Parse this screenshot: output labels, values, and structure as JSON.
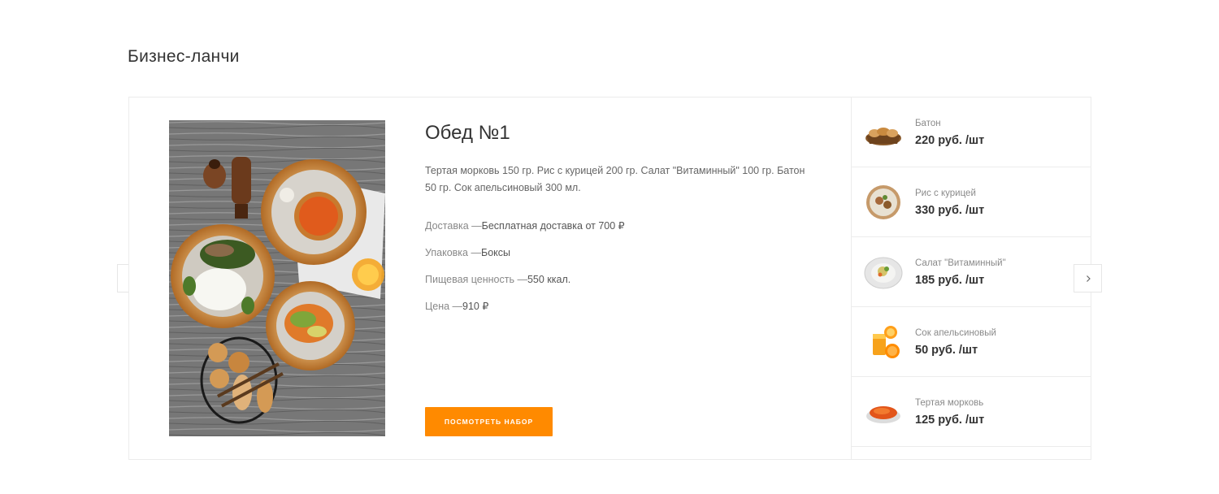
{
  "section": {
    "title": "Бизнес-ланчи"
  },
  "lunch": {
    "title": "Обед №1",
    "description": "Тертая морковь 150 гр.  Рис с курицей 200 гр.  Салат \"Витаминный\" 100 гр.  Батон 50 гр.  Сок апельсиновый 300 мл.",
    "properties": [
      {
        "label": "Доставка —",
        "value": "Бесплатная доставка от 700 ₽"
      },
      {
        "label": "Упаковка —",
        "value": "Боксы"
      },
      {
        "label": "Пищевая ценность —",
        "value": "550 ккал."
      },
      {
        "label": "Цена —",
        "value": "910 ₽"
      }
    ],
    "button_label": "Посмотреть набор"
  },
  "items": [
    {
      "name": "Батон",
      "price": "220 руб. /шт",
      "icon": "bread-basket-icon"
    },
    {
      "name": "Рис с курицей",
      "price": "330 руб. /шт",
      "icon": "rice-chicken-icon"
    },
    {
      "name": "Салат \"Витаминный\"",
      "price": "185 руб. /шт",
      "icon": "salad-icon"
    },
    {
      "name": "Сок апельсиновый",
      "price": "50 руб. /шт",
      "icon": "orange-juice-icon"
    },
    {
      "name": "Тертая морковь",
      "price": "125 руб. /шт",
      "icon": "grated-carrot-icon"
    }
  ],
  "colors": {
    "accent": "#ff8a00",
    "border": "#ececec"
  }
}
